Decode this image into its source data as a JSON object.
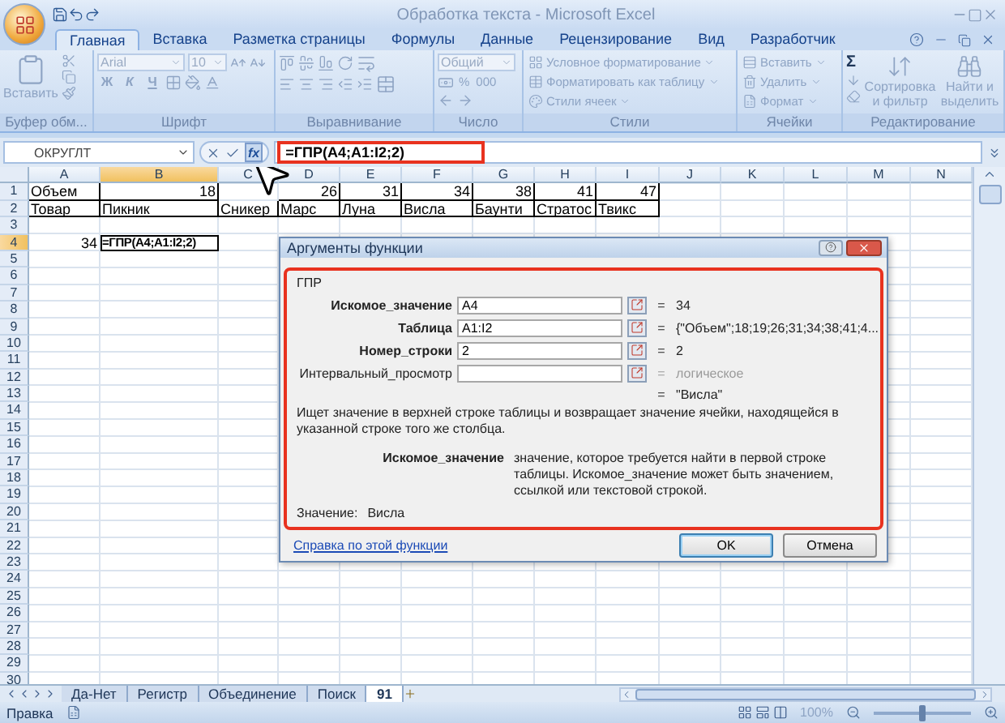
{
  "window": {
    "title": "Обработка текста - Microsoft Excel"
  },
  "ribbon_tabs": [
    {
      "label": "Главная",
      "selected": true
    },
    {
      "label": "Вставка",
      "selected": false
    },
    {
      "label": "Разметка страницы",
      "selected": false
    },
    {
      "label": "Формулы",
      "selected": false
    },
    {
      "label": "Данные",
      "selected": false
    },
    {
      "label": "Рецензирование",
      "selected": false
    },
    {
      "label": "Вид",
      "selected": false
    },
    {
      "label": "Разработчик",
      "selected": false
    }
  ],
  "ribbon": {
    "disabled": true,
    "groups": [
      {
        "kind": "clipboard",
        "title": "Буфер обм...",
        "paste": "Вставить"
      },
      {
        "kind": "font",
        "title": "Шрифт",
        "font": "Arial",
        "size": "10",
        "styles": [
          "Ж",
          "К",
          "Ч"
        ]
      },
      {
        "kind": "alignment",
        "title": "Выравнивание"
      },
      {
        "kind": "number",
        "title": "Число",
        "format": "Общий",
        "percent": "%",
        "thousands": "000"
      },
      {
        "kind": "styles",
        "title": "Стили",
        "items": [
          "Условное форматирование",
          "Форматировать как таблицу",
          "Стили ячеек"
        ]
      },
      {
        "kind": "cells",
        "title": "Ячейки",
        "items": [
          "Вставить",
          "Удалить",
          "Формат"
        ]
      },
      {
        "kind": "editing",
        "title": "Редактирование",
        "sum": "Σ",
        "items": [
          "Сортировка и фильтр",
          "Найти и выделить"
        ]
      }
    ]
  },
  "formula_bar": {
    "name_box": "ОКРУГЛТ",
    "function_button": "fx",
    "formula": "=ГПР(A4;A1:I2;2)",
    "highlighted": true
  },
  "sheet": {
    "columns": [
      {
        "label": "A",
        "selected": false
      },
      {
        "label": "B",
        "selected": true
      },
      {
        "label": "C",
        "selected": false
      },
      {
        "label": "D",
        "selected": false
      },
      {
        "label": "E",
        "selected": false
      },
      {
        "label": "F",
        "selected": false
      },
      {
        "label": "G",
        "selected": false
      },
      {
        "label": "H",
        "selected": false
      },
      {
        "label": "I",
        "selected": false
      },
      {
        "label": "J",
        "selected": false
      },
      {
        "label": "K",
        "selected": false
      },
      {
        "label": "L",
        "selected": false
      },
      {
        "label": "M",
        "selected": false
      },
      {
        "label": "N",
        "selected": false
      }
    ],
    "rows": [
      {
        "number": "1",
        "selected": false,
        "cells": [
          {
            "text": "Объем",
            "kind": "text",
            "table": true
          },
          {
            "text": "18",
            "kind": "number",
            "table": true
          },
          null,
          {
            "text": "26",
            "kind": "number",
            "table": true
          },
          {
            "text": "31",
            "kind": "number",
            "table": true
          },
          {
            "text": "34",
            "kind": "number",
            "table": true
          },
          {
            "text": "38",
            "kind": "number",
            "table": true
          },
          {
            "text": "41",
            "kind": "number",
            "table": true
          },
          {
            "text": "47",
            "kind": "number",
            "table": true
          }
        ]
      },
      {
        "number": "2",
        "selected": false,
        "cells": [
          {
            "text": "Товар",
            "kind": "text",
            "table": true
          },
          {
            "text": "Пикник",
            "kind": "text",
            "table": true
          },
          {
            "text": "Сникер",
            "kind": "text",
            "table": true
          },
          {
            "text": "Марс",
            "kind": "text",
            "table": true
          },
          {
            "text": "Луна",
            "kind": "text",
            "table": true
          },
          {
            "text": "Висла",
            "kind": "text",
            "table": true
          },
          {
            "text": "Баунти",
            "kind": "text",
            "table": true
          },
          {
            "text": "Стратос",
            "kind": "text",
            "table": true
          },
          {
            "text": "Твикс",
            "kind": "text",
            "table": true
          }
        ]
      },
      {
        "number": "3",
        "selected": false
      },
      {
        "number": "4",
        "selected": true,
        "cells": [
          {
            "text": "34",
            "kind": "number",
            "table": false
          },
          {
            "text": "=ГПР(A4;A1:I2;2)",
            "kind": "formula",
            "table": false,
            "active": true
          }
        ]
      },
      {
        "number": "5",
        "selected": false
      },
      {
        "number": "6",
        "selected": false
      },
      {
        "number": "7",
        "selected": false
      },
      {
        "number": "8",
        "selected": false
      },
      {
        "number": "9",
        "selected": false
      },
      {
        "number": "10",
        "selected": false
      },
      {
        "number": "11",
        "selected": false
      },
      {
        "number": "12",
        "selected": false
      },
      {
        "number": "13",
        "selected": false
      },
      {
        "number": "14",
        "selected": false
      },
      {
        "number": "15",
        "selected": false
      },
      {
        "number": "16",
        "selected": false
      },
      {
        "number": "17",
        "selected": false
      },
      {
        "number": "18",
        "selected": false
      },
      {
        "number": "19",
        "selected": false
      },
      {
        "number": "20",
        "selected": false
      },
      {
        "number": "21",
        "selected": false
      },
      {
        "number": "22",
        "selected": false
      },
      {
        "number": "23",
        "selected": false
      },
      {
        "number": "24",
        "selected": false
      },
      {
        "number": "25",
        "selected": false
      },
      {
        "number": "26",
        "selected": false
      },
      {
        "number": "27",
        "selected": false
      },
      {
        "number": "28",
        "selected": false
      },
      {
        "number": "29",
        "selected": false
      },
      {
        "number": "30",
        "selected": false
      }
    ]
  },
  "dialog": {
    "title": "Аргументы функции",
    "highlighted": true,
    "function": "ГПР",
    "arguments": [
      {
        "label": "Искомое_значение",
        "value": "A4",
        "sign": "=",
        "result": "34",
        "required": true
      },
      {
        "label": "Таблица",
        "value": "A1:I2",
        "sign": "=",
        "result": "{\"Объем\";18;19;26;31;34;38;41;4...",
        "required": true
      },
      {
        "label": "Номер_строки",
        "value": "2",
        "sign": "=",
        "result": "2",
        "required": true
      },
      {
        "label": "Интервальный_просмотр",
        "sign": "=",
        "result": "логическое",
        "required": false
      }
    ],
    "result_sign": "=",
    "result": "\"Висла\"",
    "description": "Ищет значение в верхней строке таблицы и возвращает значение ячейки, находящейся в указанной строке того же столбца.",
    "argument_help": {
      "name": "Искомое_значение",
      "text": "значение, которое требуется найти в первой строке таблицы. Искомое_значение может быть значением, ссылкой или текстовой строкой."
    },
    "value_label": "Значение:",
    "value": "Висла",
    "help_link": "Справка по этой функции",
    "buttons": [
      {
        "label": "OK",
        "default": true
      },
      {
        "label": "Отмена",
        "default": false
      }
    ]
  },
  "sheet_tabs": [
    {
      "label": "Да-Нет",
      "selected": false
    },
    {
      "label": "Регистр",
      "selected": false
    },
    {
      "label": "Объединение",
      "selected": false
    },
    {
      "label": "Поиск",
      "selected": false
    },
    {
      "label": "91",
      "selected": true
    }
  ],
  "status_bar": {
    "mode": "Правка",
    "zoom": {
      "label": "100%",
      "level": 0.5
    }
  }
}
